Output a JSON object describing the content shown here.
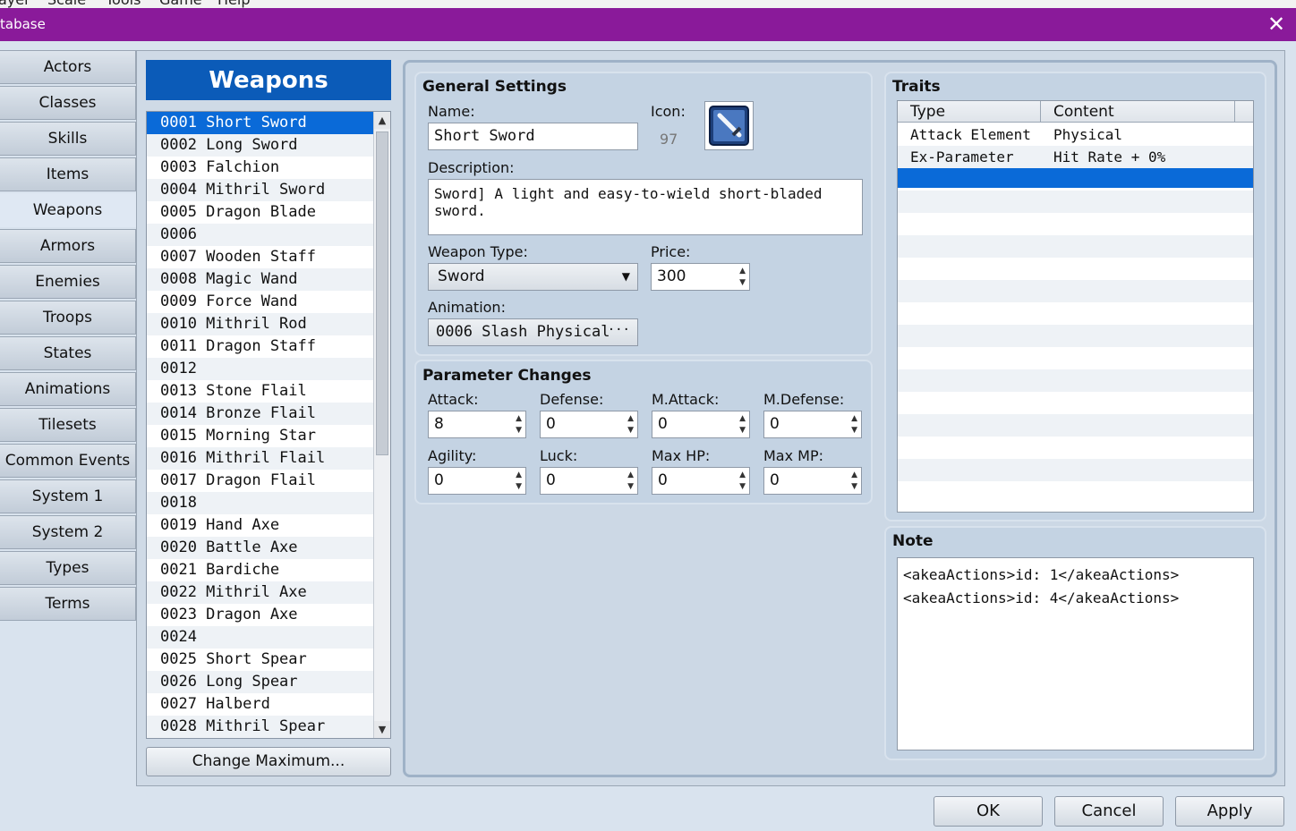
{
  "menubar": {
    "items": [
      "ayer",
      "Scale",
      "Tools",
      "Game",
      "Help"
    ]
  },
  "window": {
    "title": "tabase",
    "close_glyph": "✕"
  },
  "categories": [
    "Actors",
    "Classes",
    "Skills",
    "Items",
    "Weapons",
    "Armors",
    "Enemies",
    "Troops",
    "States",
    "Animations",
    "Tilesets",
    "Common Events",
    "System 1",
    "System 2",
    "Types",
    "Terms"
  ],
  "active_category": "Weapons",
  "list": {
    "header": "Weapons",
    "items": [
      "0001 Short Sword",
      "0002 Long Sword",
      "0003 Falchion",
      "0004 Mithril Sword",
      "0005 Dragon Blade",
      "0006",
      "0007 Wooden Staff",
      "0008 Magic Wand",
      "0009 Force Wand",
      "0010 Mithril Rod",
      "0011 Dragon Staff",
      "0012",
      "0013 Stone Flail",
      "0014 Bronze Flail",
      "0015 Morning Star",
      "0016 Mithril Flail",
      "0017 Dragon Flail",
      "0018",
      "0019 Hand Axe",
      "0020 Battle Axe",
      "0021 Bardiche",
      "0022 Mithril Axe",
      "0023 Dragon Axe",
      "0024",
      "0025 Short Spear",
      "0026 Long Spear",
      "0027 Halberd",
      "0028 Mithril Spear"
    ],
    "selected_index": 0,
    "change_max_label": "Change Maximum...",
    "scroll_up": "▲",
    "scroll_down": "▼"
  },
  "general": {
    "title": "General Settings",
    "name_label": "Name:",
    "name_value": "Short Sword",
    "icon_label": "Icon:",
    "icon_index": "97",
    "icon_name": "sword-icon",
    "description_label": "Description:",
    "description_value": "Sword] A light and easy-to-wield short-bladed sword.",
    "weapon_type_label": "Weapon Type:",
    "weapon_type_value": "Sword",
    "price_label": "Price:",
    "price_value": "300",
    "animation_label": "Animation:",
    "animation_value": "0006 Slash Physical",
    "animation_button": "···"
  },
  "params": {
    "title": "Parameter Changes",
    "fields": [
      {
        "label": "Attack:",
        "value": "8"
      },
      {
        "label": "Defense:",
        "value": "0"
      },
      {
        "label": "M.Attack:",
        "value": "0"
      },
      {
        "label": "M.Defense:",
        "value": "0"
      },
      {
        "label": "Agility:",
        "value": "0"
      },
      {
        "label": "Luck:",
        "value": "0"
      },
      {
        "label": "Max HP:",
        "value": "0"
      },
      {
        "label": "Max MP:",
        "value": "0"
      }
    ]
  },
  "traits": {
    "title": "Traits",
    "columns": [
      "Type",
      "Content"
    ],
    "rows": [
      {
        "type": "Attack Element",
        "content": "Physical"
      },
      {
        "type": "Ex-Parameter",
        "content": "Hit Rate + 0%"
      }
    ]
  },
  "note": {
    "title": "Note",
    "lines": [
      "<akeaActions>id: 1</akeaActions>",
      "<akeaActions>id: 4</akeaActions>"
    ]
  },
  "footer": {
    "ok": "OK",
    "cancel": "Cancel",
    "apply": "Apply"
  },
  "colors": {
    "titlebar": "#8a1a9a",
    "selection": "#0a6ad8",
    "list_header": "#0b5bb8"
  }
}
